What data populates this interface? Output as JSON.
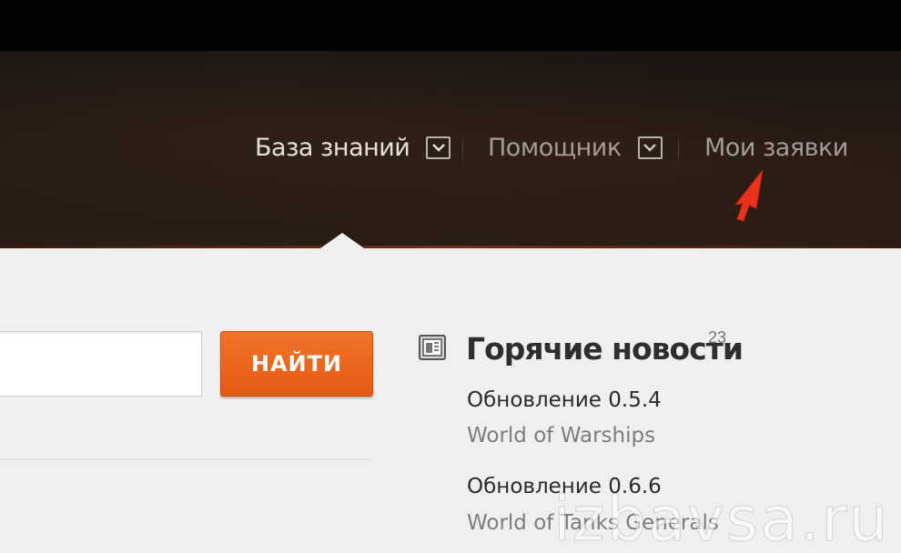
{
  "nav": {
    "knowledge_base": "База знаний",
    "assistant": "Помощник",
    "my_tickets": "Мои заявки"
  },
  "search": {
    "value": "",
    "placeholder": "",
    "button_label": "НАЙТИ"
  },
  "hot_news": {
    "title": "Горячие новости",
    "count": "23",
    "items": [
      {
        "title": "Обновление 0.5.4",
        "game": "World of Warships"
      },
      {
        "title": "Обновление 0.6.6",
        "game": "World of Tanks Generals"
      }
    ]
  },
  "watermark": "izbavsa.ru",
  "colors": {
    "accent_orange": "#e55a12",
    "header_bg": "#241a14",
    "content_bg": "#efefee",
    "cursor_red": "#e8321c"
  },
  "icons": [
    "chevron-down-icon",
    "news-icon",
    "cursor-arrow-icon"
  ]
}
